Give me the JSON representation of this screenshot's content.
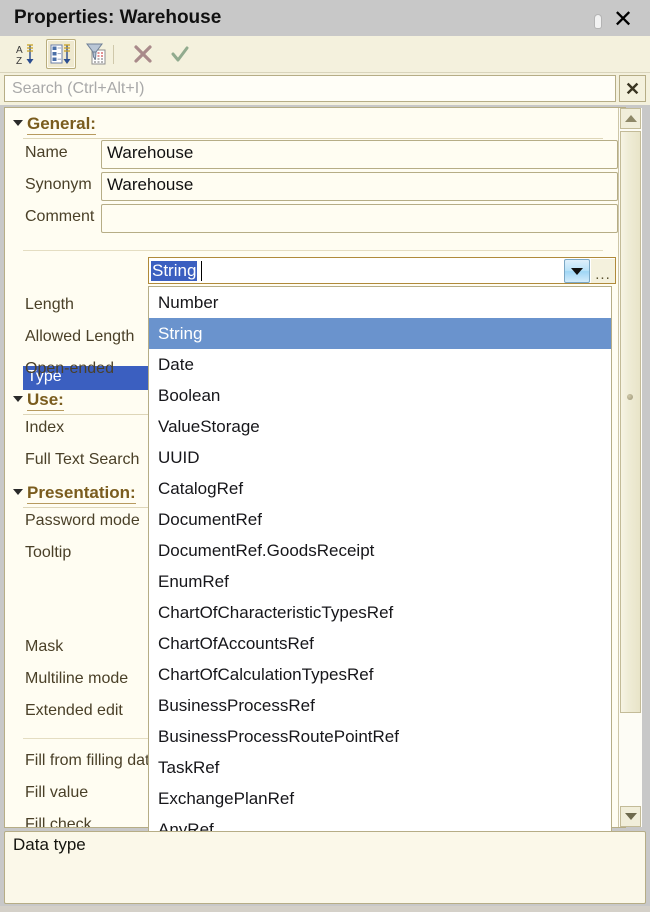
{
  "window": {
    "title": "Properties: Warehouse",
    "buttons": {
      "autohide_pin": "pin-icon",
      "close": "✕"
    }
  },
  "toolbar": {
    "items": [
      {
        "name": "sort-alphabetical-button",
        "tooltip": "Sort alphabetically",
        "pressed": false
      },
      {
        "name": "sort-by-category-button",
        "tooltip": "Sort by category",
        "pressed": true
      },
      {
        "name": "filter-button",
        "tooltip": "Filter",
        "pressed": false
      },
      {
        "name": "cancel-button",
        "glyph": "✕",
        "pressed": false
      },
      {
        "name": "apply-button",
        "glyph": "✓",
        "pressed": false
      }
    ]
  },
  "search": {
    "value": "",
    "placeholder": "Search (Ctrl+Alt+I)",
    "clear_label": "✕"
  },
  "sections": [
    {
      "label": "General:",
      "expanded": true
    },
    {
      "label": "Use:",
      "expanded": true
    },
    {
      "label": "Presentation:",
      "expanded": true
    }
  ],
  "properties": [
    {
      "label": "Name",
      "value": "Warehouse",
      "editor": "text"
    },
    {
      "label": "Synonym",
      "value": "Warehouse",
      "editor": "text"
    },
    {
      "label": "Comment",
      "value": "",
      "editor": "text"
    },
    {
      "label": "Type",
      "value": "String",
      "editor": "combo",
      "selected": true
    },
    {
      "label": "Length",
      "value": "",
      "editor": "text"
    },
    {
      "label": "Allowed Length",
      "value": "",
      "editor": "text"
    },
    {
      "label": "Open-ended",
      "value": "",
      "editor": "text"
    },
    {
      "label": "Index",
      "value": "",
      "editor": "text"
    },
    {
      "label": "Full Text Search",
      "value": "",
      "editor": "text"
    },
    {
      "label": "Password mode",
      "value": "",
      "editor": "text"
    },
    {
      "label": "Tooltip",
      "value": "",
      "editor": "text"
    },
    {
      "label": "Mask",
      "value": "",
      "editor": "text"
    },
    {
      "label": "Multiline mode",
      "value": "",
      "editor": "text"
    },
    {
      "label": "Extended edit",
      "value": "",
      "editor": "text"
    },
    {
      "label": "Fill from filling dat",
      "value": "",
      "editor": "text"
    },
    {
      "label": "Fill value",
      "value": "",
      "editor": "text"
    },
    {
      "label": "Fill check",
      "value": "",
      "editor": "text"
    }
  ],
  "type_editor": {
    "value": "String",
    "dropdown_glyph": "▼",
    "select_glyph": "..."
  },
  "type_dropdown": {
    "open": true,
    "selected": "String",
    "options": [
      "Number",
      "String",
      "Date",
      "Boolean",
      "ValueStorage",
      "UUID",
      "CatalogRef",
      "DocumentRef",
      "DocumentRef.GoodsReceipt",
      "EnumRef",
      "ChartOfCharacteristicTypesRef",
      "ChartOfAccountsRef",
      "ChartOfCalculationTypesRef",
      "BusinessProcessRef",
      "BusinessProcessRoutePointRef",
      "TaskRef",
      "ExchangePlanRef",
      "AnyRef"
    ]
  },
  "scrollbar": {
    "up_glyph": "▲",
    "down_glyph": "▼"
  },
  "description_pane": {
    "title": "Data type",
    "body": ""
  },
  "colors": {
    "titlebar": "#c8c8c8",
    "toolbar": "#f4f1dd",
    "field_background": "#fffdf2",
    "selection_blue": "#3b5fc0",
    "dropdown_selection": "#6a93cd",
    "section_label": "#7a5c1e",
    "property_label": "#4a4028",
    "border": "#b6ad86"
  }
}
